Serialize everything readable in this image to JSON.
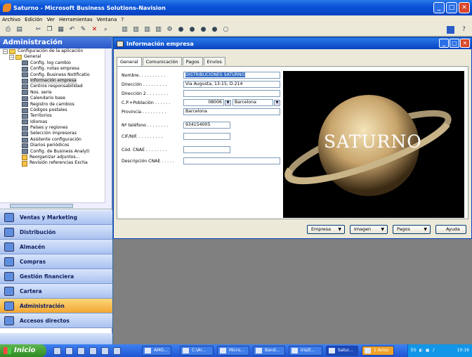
{
  "window": {
    "title": "Saturno - Microsoft Business Solutions-Navision"
  },
  "menu": [
    "Archivo",
    "Edición",
    "Ver",
    "Herramientas",
    "Ventana",
    "?"
  ],
  "nav": {
    "header": "Administración",
    "tree": [
      {
        "label": "Configuración de la aplicación",
        "level": 0,
        "icon": "folder"
      },
      {
        "label": "General",
        "level": 1,
        "icon": "folder"
      },
      {
        "label": "Config. log cambio",
        "level": 2,
        "icon": "page"
      },
      {
        "label": "Config. notas empresa",
        "level": 2,
        "icon": "page"
      },
      {
        "label": "Config. Business Notificatio",
        "level": 2,
        "icon": "page"
      },
      {
        "label": "Información empresa",
        "level": 2,
        "icon": "page",
        "selected": true
      },
      {
        "label": "Centros responsabilidad",
        "level": 2,
        "icon": "page"
      },
      {
        "label": "Nos. serie",
        "level": 2,
        "icon": "page"
      },
      {
        "label": "Calendario base",
        "level": 2,
        "icon": "page"
      },
      {
        "label": "Registro de cambios",
        "level": 2,
        "icon": "page"
      },
      {
        "label": "Códigos postales",
        "level": 2,
        "icon": "page"
      },
      {
        "label": "Territorios",
        "level": 2,
        "icon": "page"
      },
      {
        "label": "Idiomas",
        "level": 2,
        "icon": "page"
      },
      {
        "label": "Países y regiones",
        "level": 2,
        "icon": "page"
      },
      {
        "label": "Selección impresoras",
        "level": 2,
        "icon": "page"
      },
      {
        "label": "Asistente configuración",
        "level": 2,
        "icon": "page"
      },
      {
        "label": "Diarios periódicos",
        "level": 2,
        "icon": "page"
      },
      {
        "label": "Config. de Business Analyti",
        "level": 2,
        "icon": "page"
      },
      {
        "label": "Reorganizar adjuntos...",
        "level": 2,
        "icon": "report"
      },
      {
        "label": "Revisión referencias Excha",
        "level": 2,
        "icon": "report"
      }
    ],
    "sections": [
      {
        "label": "Ventas y Marketing",
        "active": false
      },
      {
        "label": "Distribución",
        "active": false
      },
      {
        "label": "Almacén",
        "active": false
      },
      {
        "label": "Compras",
        "active": false
      },
      {
        "label": "Gestión financiera",
        "active": false
      },
      {
        "label": "Cartera",
        "active": false
      },
      {
        "label": "Administración",
        "active": true
      },
      {
        "label": "Accesos directos",
        "active": false
      }
    ]
  },
  "form": {
    "title": "Información empresa",
    "tabs": [
      "General",
      "Comunicación",
      "Pagos",
      "Envíos"
    ],
    "fields": {
      "nombre_label": "Nombre. . . . . . . . . .",
      "nombre_value": "DISTRIBUCIONES SATURNO",
      "direccion_label": "Dirección . . . . . . . . .",
      "direccion_value": "Via Augusta, 13-15, D.214",
      "direccion2_label": "Dirección 2 . . . . . . . .",
      "direccion2_value": "",
      "cp_label": "C.P.+Población . . . . . .",
      "cp_value": "08006",
      "poblacion_value": "Barcelona",
      "provincia_label": "Provincia . . . . . . . . .",
      "provincia_value": "Barcelona",
      "telefono_label": "Nº teléfono . . . . . . . .",
      "telefono_value": "934154005",
      "cif_label": "CIF/NIF. . . . . . . . . .",
      "cif_value": "",
      "cnae_label": "Cód. CNAE . . . . . . . .",
      "cnae_value": "",
      "desc_cnae_label": "Descripción CNAE . . . . .",
      "desc_cnae_value": ""
    },
    "picture_text": "SATURNO",
    "buttons": [
      "Empresa",
      "Imagen",
      "Pagos",
      "Ayuda"
    ]
  },
  "taskbar": {
    "start": "Inicio",
    "tasks": [
      "AMO...",
      "C:\\Ar...",
      "Micro...",
      "Band...",
      "Iris/E...",
      "Satur...",
      "1 Aviso"
    ],
    "tray_lang": "ES",
    "clock": "10:16"
  }
}
